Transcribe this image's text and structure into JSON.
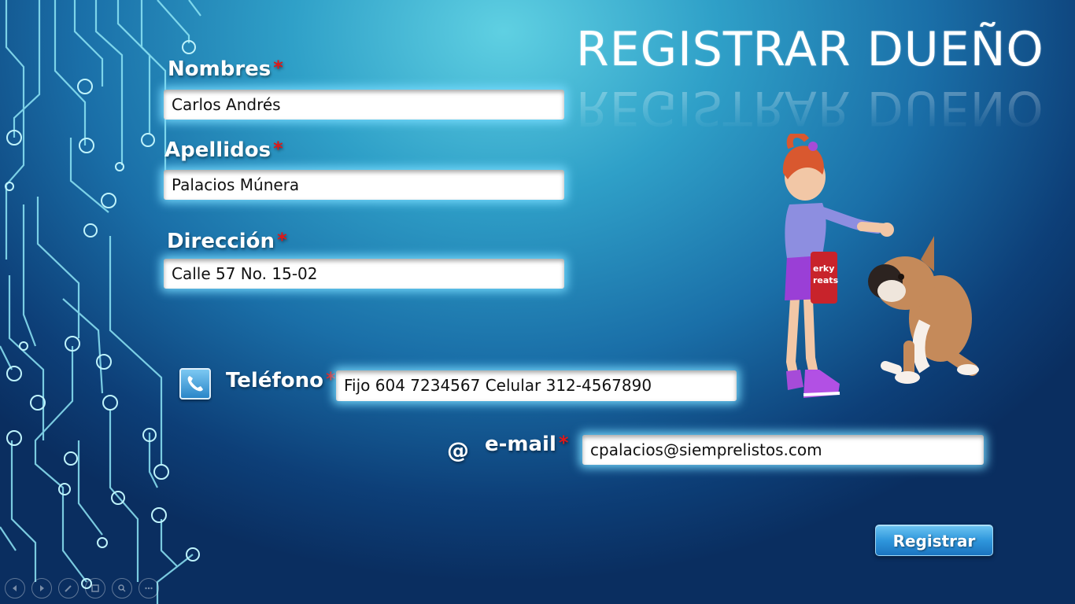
{
  "slide": {
    "title": "REGISTRAR DUEÑO"
  },
  "form": {
    "nombres": {
      "label": "Nombres",
      "required_mark": "*",
      "value": "Carlos Andrés"
    },
    "apellidos": {
      "label": "Apellidos",
      "required_mark": "*",
      "value": "Palacios Múnera"
    },
    "direccion": {
      "label": "Dirección",
      "required_mark": "*",
      "value": "Calle 57 No. 15-02"
    },
    "telefono": {
      "label": "Teléfono",
      "required_mark": "*",
      "value": "Fijo 604 7234567 Celular 312-4567890",
      "icon": "phone-icon"
    },
    "email": {
      "label": "e-mail",
      "required_mark": "*",
      "value": "cpalacios@siemprelistos.com",
      "icon_glyph": "@"
    }
  },
  "actions": {
    "register_label": "Registrar"
  },
  "colors": {
    "required": "#e01818",
    "button": "#2f97dc",
    "background_light": "#5fd0e2",
    "background_dark": "#0a2e60"
  },
  "player_controls": [
    "previous-icon",
    "next-icon",
    "pen-icon",
    "slides-icon",
    "zoom-icon",
    "more-icon"
  ]
}
